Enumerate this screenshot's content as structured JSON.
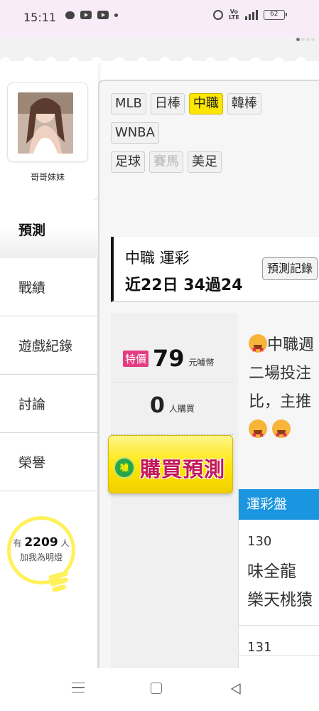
{
  "status_bar": {
    "time": "15:11",
    "battery": "62",
    "network": "4G+"
  },
  "profile": {
    "name": "哥哥妹妹"
  },
  "left_nav": {
    "active": "預測",
    "items": [
      {
        "label": "戰績"
      },
      {
        "label": "遊戲紀錄"
      },
      {
        "label": "討論"
      },
      {
        "label": "榮譽"
      }
    ]
  },
  "follow": {
    "prefix": "有",
    "count": "2209",
    "suffix": "人",
    "line2": "加我為明燈"
  },
  "league_tags": {
    "rows": [
      [
        "MLB",
        "日棒",
        "中職",
        "韓棒"
      ],
      [
        "WNBA"
      ],
      [
        "足球",
        "賽馬",
        "美足"
      ]
    ],
    "active": "中職",
    "disabled": "賽馬"
  },
  "league_header": {
    "title": "中職 運彩",
    "record": "近22日 34過24",
    "record_button": "預測記錄"
  },
  "price": {
    "badge": "特價",
    "value": "79",
    "unit": "元噱幣",
    "buyers": "0",
    "buyers_unit": "人購買"
  },
  "buy_button": {
    "label": "購買預測",
    "coin": "噱"
  },
  "description": {
    "lines": [
      "中職週",
      "二場投注",
      "比，主推"
    ]
  },
  "table": {
    "header": "運彩盤",
    "games": [
      {
        "no": "130",
        "teams": [
          "味全龍",
          "樂天桃猿"
        ]
      },
      {
        "no": "131",
        "teams": []
      }
    ]
  },
  "colors": {
    "accent_yellow": "#ffe600",
    "badge_pink": "#e43b82",
    "table_blue": "#1a95e0"
  },
  "icons": {
    "status_left": [
      "message-icon",
      "youtube-icon",
      "youtube-icon",
      "dot-icon"
    ],
    "status_right": [
      "alarm-icon",
      "volte-icon",
      "signal-icon",
      "battery-icon"
    ],
    "nav": [
      "menu-icon",
      "home-icon",
      "back-icon"
    ]
  }
}
